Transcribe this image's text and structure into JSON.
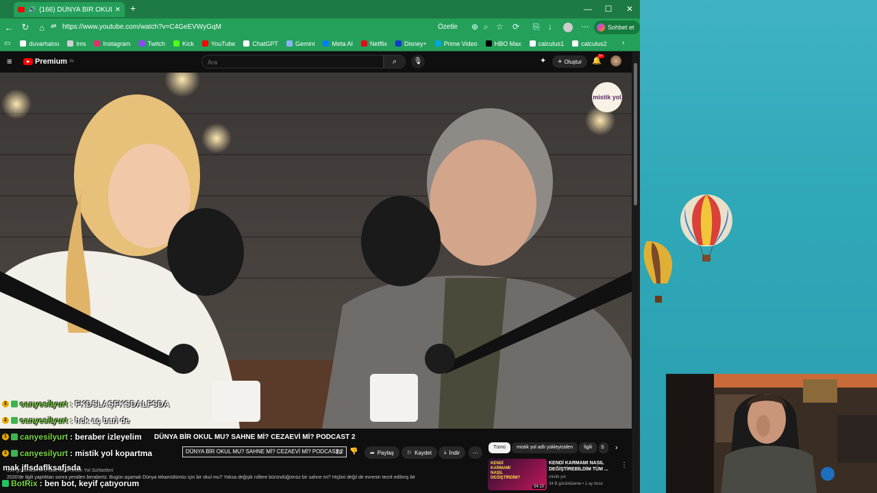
{
  "browser": {
    "tab_title": "(166) DÜNYA BİR OKUL MU? SAHNE MI? CEZAEVI MI? PODCAST 2",
    "url": "https://www.youtube.com/watch?v=C4GeEVWyGqM",
    "summarize_label": "Özetle",
    "chat_button_label": "Sohbet et",
    "bookmarks": [
      {
        "label": "duvarhalısı",
        "color": "#ffffff"
      },
      {
        "label": "lms",
        "color": "#d0d0d0"
      },
      {
        "label": "Instagram",
        "color": "#e1306c"
      },
      {
        "label": "Twitch",
        "color": "#9146ff"
      },
      {
        "label": "Kick",
        "color": "#53fc18"
      },
      {
        "label": "YouTube",
        "color": "#ff0000"
      },
      {
        "label": "ChatGPT",
        "color": "#ffffff"
      },
      {
        "label": "Gemini",
        "color": "#8ab4f8"
      },
      {
        "label": "Meta AI",
        "color": "#0081fb"
      },
      {
        "label": "Netflix",
        "color": "#e50914"
      },
      {
        "label": "Disney+",
        "color": "#113ccf"
      },
      {
        "label": "Prime Video",
        "color": "#00a8e1"
      },
      {
        "label": "HBO Max",
        "color": "#000000"
      },
      {
        "label": "calculus1",
        "color": "#ffffff"
      },
      {
        "label": "calculus2",
        "color": "#ffffff"
      }
    ]
  },
  "youtube": {
    "logo_text": "Premium",
    "logo_sup": "TR",
    "search_placeholder": "Ara",
    "create_label": "Oluştur",
    "notif_count": "9+",
    "watermark": "mistik yol",
    "video_title": "DÜNYA BİR OKUL MU? SAHNE Mİ? CEZAEVİ Mİ? PODCAST 2",
    "tooltip": "DÜNYA BİR OKUL MU? SAHNE Mİ? CEZAEVİ Mİ? PODCAST 2",
    "like_count": "89",
    "actions": {
      "share": "Paylaş",
      "save": "Kaydet",
      "download": "İndir"
    },
    "channel": "mistik yol",
    "desc_meta": "800 görüntüleme  2 saat önce  Mistik Yol Sohbetleri",
    "desc_text": "2020'de ilgili yaptıktan sonra yeniden beraberiz. Bugün aşamalı Dünya tekamülümüz için bir okul mu? Yoksa değişik rollere büründüğümüz bir sahne mi? Hiçbiri değil de evrenin tecrit edilmiş bir",
    "chips": [
      "Tümü",
      "mistik yol adlı yükleyiciden",
      "İlgili",
      "S"
    ],
    "recommendation": {
      "title": "KENDİ KARMAMI NASIL DEĞİŞTİREBİLDİM TÜM ...",
      "thumb_text": "KENDİ KARMAMI NASIL DEĞİŞTİRDİM?",
      "channel": "mistik yol",
      "meta": "34 B görüntüleme • 1 ay önce",
      "duration": "54:10"
    }
  },
  "chat": [
    {
      "user": "canyesilyurt",
      "msg": ": FKDSLAŞFKSDALFSDA"
    },
    {
      "user": "canyesilyurt",
      "msg": ": hck aç bari de"
    },
    {
      "user": "canyesilyurt",
      "msg": ": beraber izleyelim"
    },
    {
      "user": "canyesilyurt",
      "msg": ": mistik yol kopartma"
    },
    {
      "user": "",
      "msg": "mak jflsdaflksafjsda"
    },
    {
      "user": "BotRix",
      "msg": ": ben bot, keyif çatıyorum"
    }
  ]
}
